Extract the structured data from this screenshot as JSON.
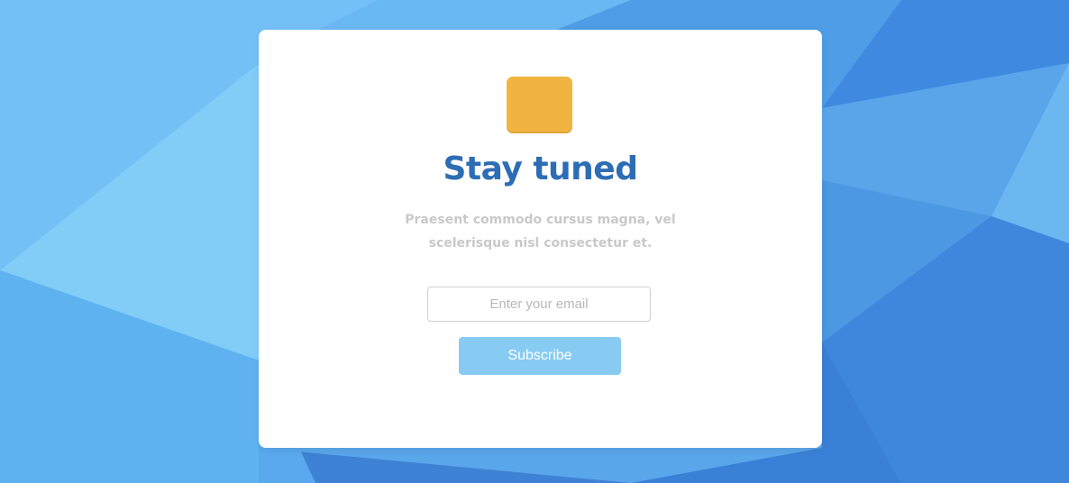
{
  "card": {
    "icon": "envelope-icon",
    "title": "Stay tuned",
    "subtitle": "Praesent commodo cursus magna, vel scelerisque nisl consectetur et.",
    "email_placeholder": "Enter your email",
    "subscribe_label": "Subscribe"
  },
  "colors": {
    "title": "#2d6db4",
    "subtitle": "#c9c9c9",
    "icon": "#f2b441",
    "button": "#87cbf3",
    "background": "#5aa6ea"
  }
}
